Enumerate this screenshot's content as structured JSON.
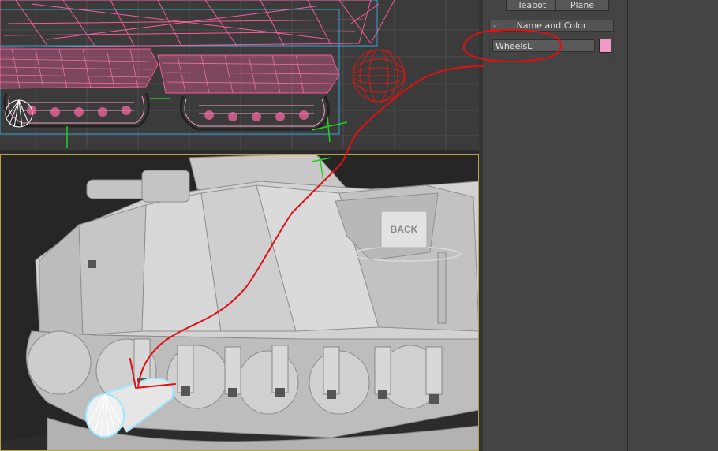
{
  "create_panel": {
    "buttons": [
      {
        "label": "Teapot"
      },
      {
        "label": "Plane"
      }
    ]
  },
  "rollout": {
    "toggle": "-",
    "title": "Name and Color",
    "object_name": "WheelsL",
    "object_color": "#f09ac6"
  },
  "viewport_persp": {
    "viewcube_face": "BACK"
  },
  "annotation": {
    "color": "#e01010"
  },
  "wire_color": "#ff5fa0",
  "selection_color": "#9fe8ff"
}
